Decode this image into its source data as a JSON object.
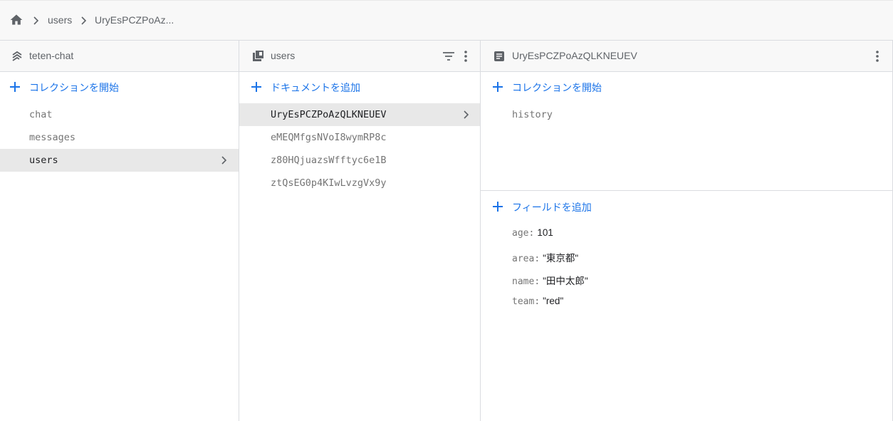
{
  "breadcrumb": {
    "home_icon": "home-icon",
    "items": [
      "users",
      "UryEsPCZPoAz..."
    ]
  },
  "columns": {
    "root": {
      "title": "teten-chat",
      "icon": "firestore-database-icon",
      "add_label": "コレクションを開始",
      "collections": [
        "chat",
        "messages",
        "users"
      ],
      "selected": "users"
    },
    "collection": {
      "title": "users",
      "icon": "collection-icon",
      "add_label": "ドキュメントを追加",
      "documents": [
        "UryEsPCZPoAzQLKNEUEV",
        "eMEQMfgsNVoI8wymRP8c",
        "z80HQjuazsWfftyc6e1B",
        "ztQsEG0p4KIwLvzgVx9y"
      ],
      "selected": "UryEsPCZPoAzQLKNEUEV"
    },
    "document": {
      "title": "UryEsPCZPoAzQLKNEUEV",
      "icon": "document-icon",
      "add_collection_label": "コレクションを開始",
      "subcollections": [
        "history"
      ],
      "add_field_label": "フィールドを追加",
      "fields": [
        {
          "key": "age",
          "value": "101"
        },
        {
          "key": "area",
          "value": "\"東京都\""
        },
        {
          "key": "name",
          "value": "\"田中太郎\""
        },
        {
          "key": "team",
          "value": "\"red\""
        }
      ]
    }
  },
  "colors": {
    "accent": "#1a73e8",
    "selected_row": "#e8e8e8",
    "header_bg": "#f8f8f8",
    "border": "#dadce0"
  }
}
